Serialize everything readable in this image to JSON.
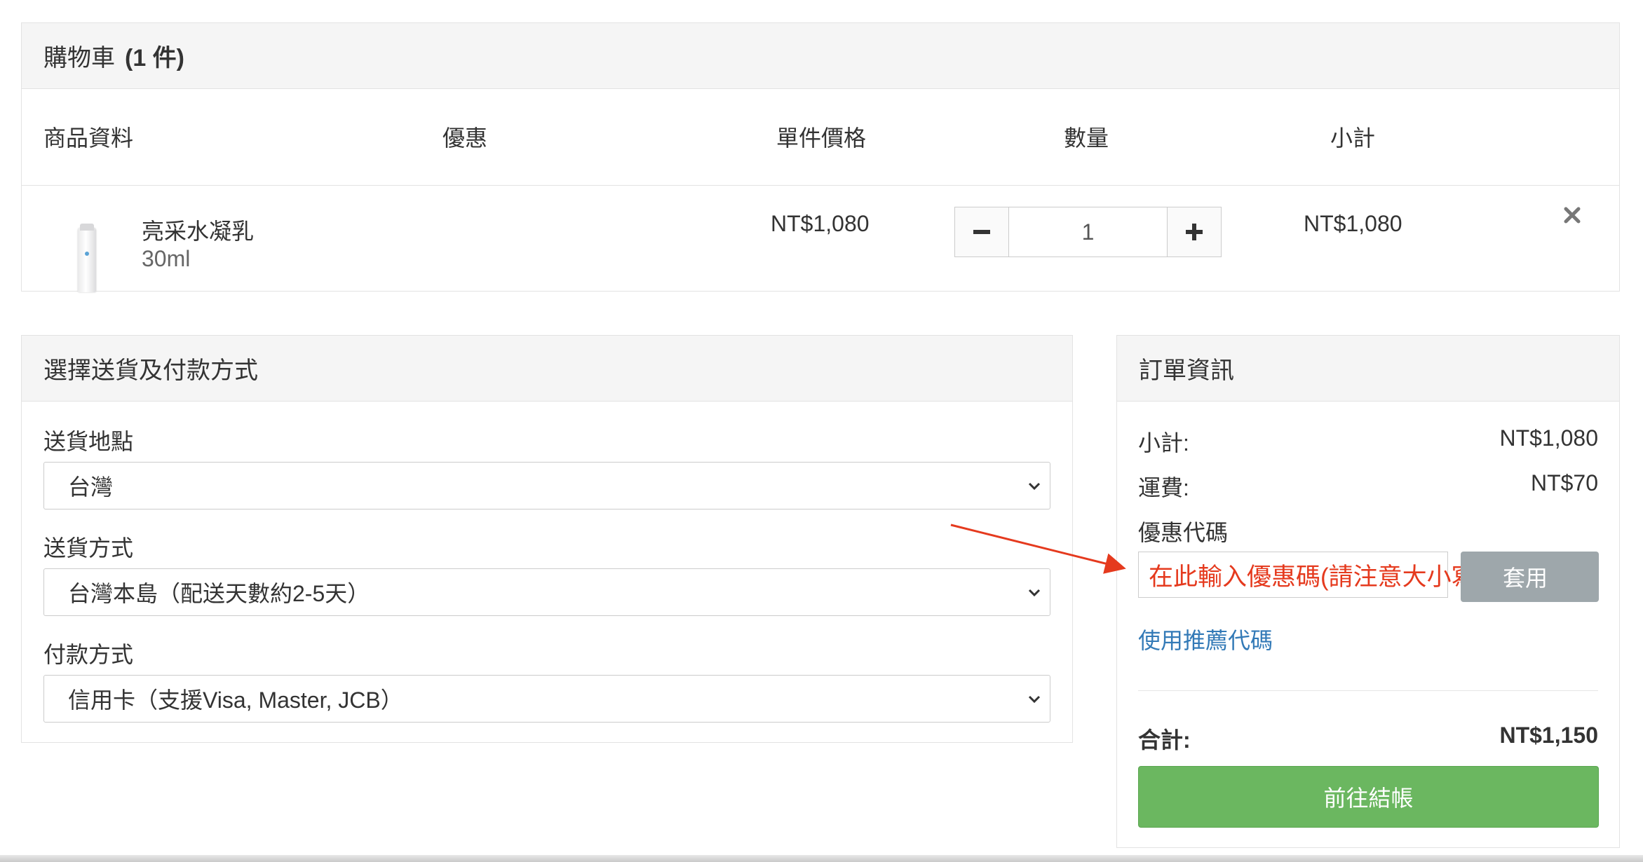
{
  "cart": {
    "title": "購物車",
    "count": "(1 件)",
    "columns": {
      "product": "商品資料",
      "discount": "優惠",
      "unit_price": "單件價格",
      "quantity": "數量",
      "subtotal": "小計"
    },
    "items": [
      {
        "name": "亮采水凝乳",
        "variant": "30ml",
        "unit_price": "NT$1,080",
        "quantity": "1",
        "subtotal": "NT$1,080"
      }
    ]
  },
  "shipping": {
    "title": "選擇送貨及付款方式",
    "location_label": "送貨地點",
    "location_value": "台灣",
    "method_label": "送貨方式",
    "method_value": "台灣本島（配送天數約2-5天）",
    "payment_label": "付款方式",
    "payment_value": "信用卡（支援Visa, Master, JCB）"
  },
  "order": {
    "title": "訂單資訊",
    "subtotal_label": "小計:",
    "subtotal_value": "NT$1,080",
    "shipping_label": "運費:",
    "shipping_value": "NT$70",
    "coupon_label": "優惠代碼",
    "coupon_placeholder": "在此輸入優惠碼(請注意大小寫)",
    "apply_label": "套用",
    "referral_link": "使用推薦代碼",
    "total_label": "合計:",
    "total_value": "NT$1,150",
    "checkout_label": "前往結帳"
  },
  "colors": {
    "annotation": "#e53a1e",
    "checkout": "#6bb760",
    "apply": "#9ea7ab",
    "link": "#337ab7"
  },
  "icons": [
    "minus-icon",
    "plus-icon",
    "close-icon",
    "chevron-down-icon",
    "arrow-annotation"
  ]
}
